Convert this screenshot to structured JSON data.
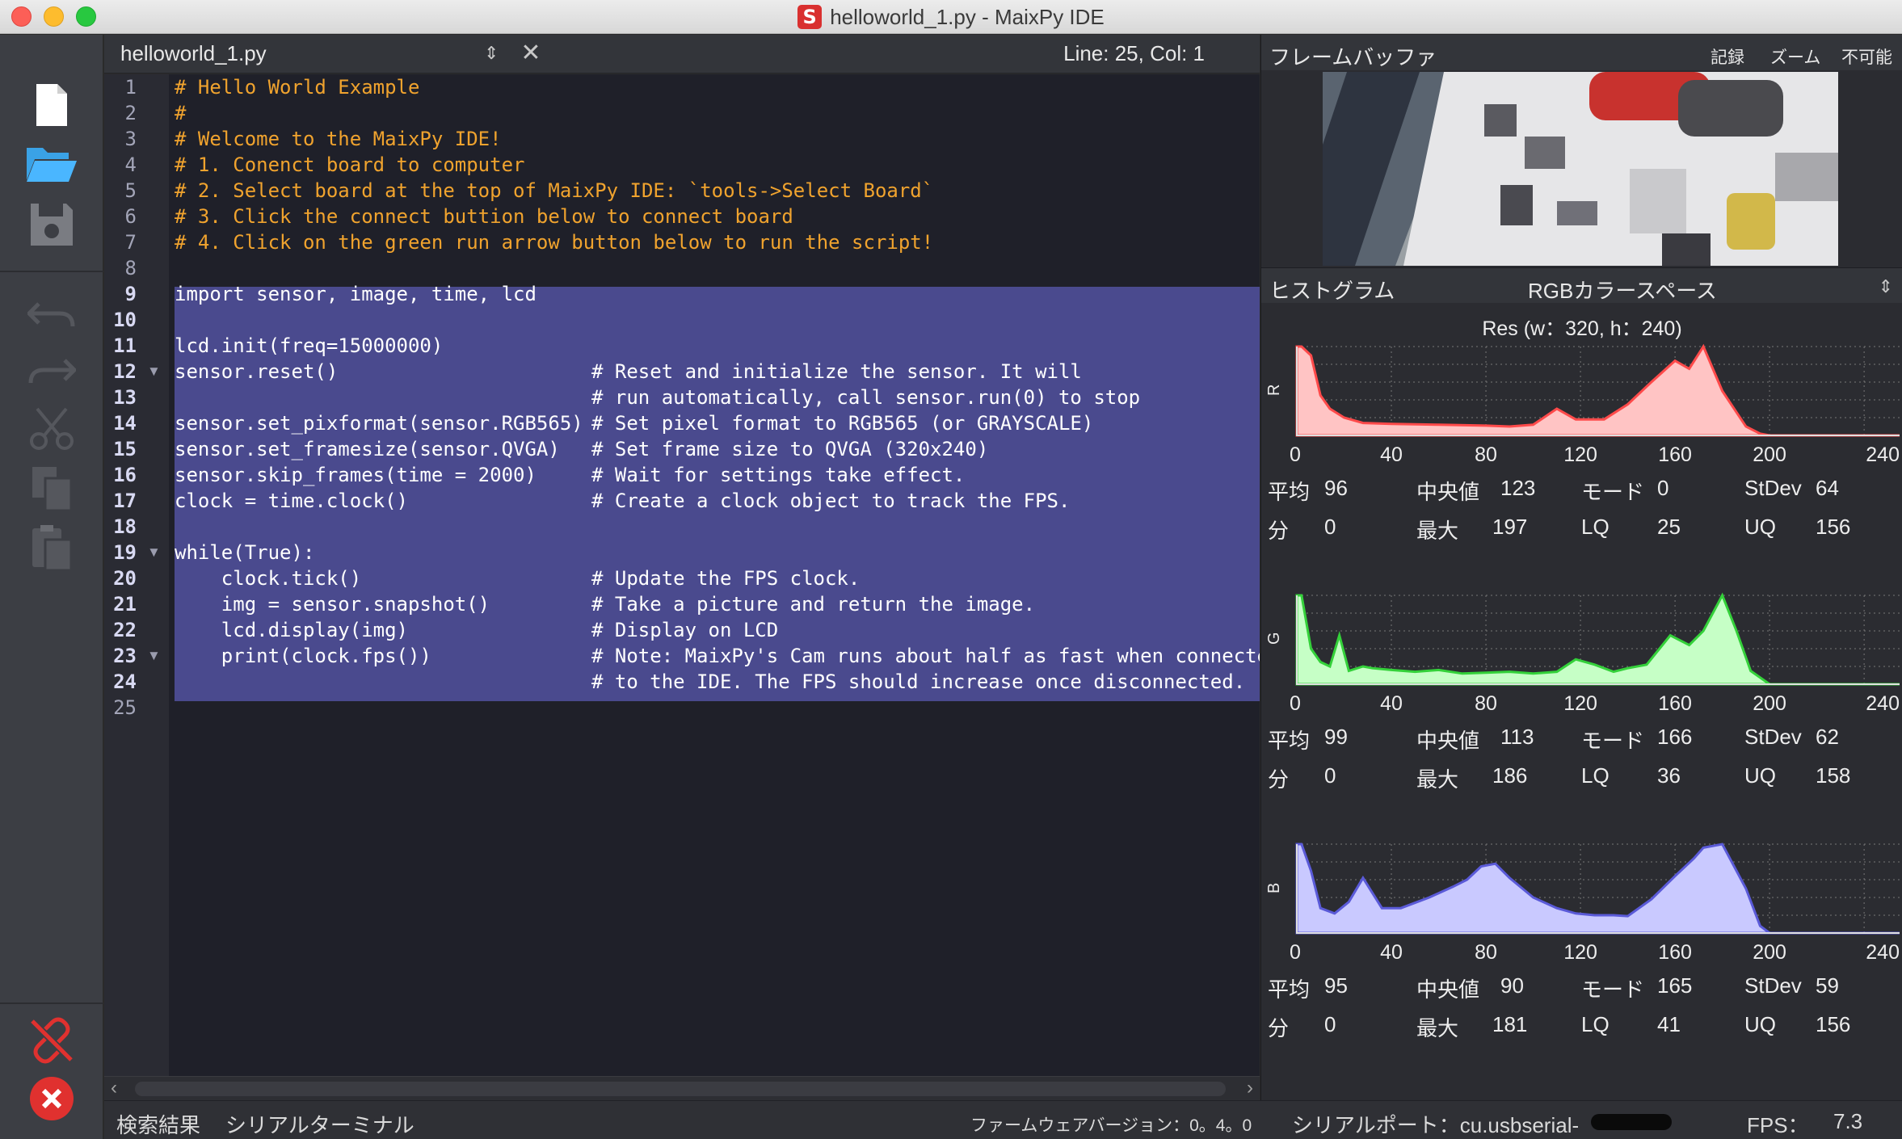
{
  "window": {
    "title": "helloworld_1.py - MaixPy IDE",
    "app_icon_letter": "S"
  },
  "editor": {
    "file_name": "helloworld_1.py",
    "position": "Line: 25, Col: 1",
    "lines": [
      {
        "n": "1",
        "text": "# Hello World Example",
        "kind": "comment"
      },
      {
        "n": "2",
        "text": "#",
        "kind": "comment"
      },
      {
        "n": "3",
        "text": "# Welcome to the MaixPy IDE!",
        "kind": "comment"
      },
      {
        "n": "4",
        "text": "# 1. Conenct board to computer",
        "kind": "comment"
      },
      {
        "n": "5",
        "text": "# 2. Select board at the top of MaixPy IDE: `tools->Select Board`",
        "kind": "comment"
      },
      {
        "n": "6",
        "text": "# 3. Click the connect buttion below to connect board",
        "kind": "comment"
      },
      {
        "n": "7",
        "text": "# 4. Click on the green run arrow button below to run the script!",
        "kind": "comment"
      },
      {
        "n": "8",
        "text": "",
        "kind": "comment"
      },
      {
        "n": "9",
        "text": "import sensor, image, time, lcd",
        "kind": "code"
      },
      {
        "n": "10",
        "text": "",
        "kind": "code"
      },
      {
        "n": "11",
        "text": "lcd.init(freq=15000000)",
        "kind": "code"
      },
      {
        "n": "12",
        "text": "sensor.reset()",
        "kind": "code",
        "comment": "# Reset and initialize the sensor. It will",
        "fold": true
      },
      {
        "n": "13",
        "text": "",
        "kind": "code",
        "comment": "# run automatically, call sensor.run(0) to stop"
      },
      {
        "n": "14",
        "text": "sensor.set_pixformat(sensor.RGB565)",
        "kind": "code",
        "comment": "# Set pixel format to RGB565 (or GRAYSCALE)"
      },
      {
        "n": "15",
        "text": "sensor.set_framesize(sensor.QVGA)",
        "kind": "code",
        "comment": "# Set frame size to QVGA (320x240)"
      },
      {
        "n": "16",
        "text": "sensor.skip_frames(time = 2000)",
        "kind": "code",
        "comment": "# Wait for settings take effect."
      },
      {
        "n": "17",
        "text": "clock = time.clock()",
        "kind": "code",
        "comment": "# Create a clock object to track the FPS."
      },
      {
        "n": "18",
        "text": "",
        "kind": "code"
      },
      {
        "n": "19",
        "text": "while(True):",
        "kind": "code",
        "fold": true
      },
      {
        "n": "20",
        "text": "    clock.tick()",
        "kind": "code",
        "comment": "# Update the FPS clock."
      },
      {
        "n": "21",
        "text": "    img = sensor.snapshot()",
        "kind": "code",
        "comment": "# Take a picture and return the image."
      },
      {
        "n": "22",
        "text": "    lcd.display(img)",
        "kind": "code",
        "comment": "# Display on LCD"
      },
      {
        "n": "23",
        "text": "    print(clock.fps())",
        "kind": "code",
        "comment": "# Note: MaixPy's Cam runs about half as fast when connecte",
        "fold": true
      },
      {
        "n": "24",
        "text": "",
        "kind": "code",
        "comment": "# to the IDE. The FPS should increase once disconnected."
      },
      {
        "n": "25",
        "text": "",
        "kind": "plain"
      }
    ]
  },
  "framebuffer": {
    "title": "フレームバッファ",
    "record": "記録",
    "zoom": "ズーム",
    "disable": "不可能"
  },
  "histogram": {
    "title": "ヒストグラム",
    "color_space": "RGBカラースペース",
    "resolution": "Res (w：320, h：240)",
    "x_ticks": [
      "0",
      "40",
      "80",
      "120",
      "160",
      "200",
      "240"
    ],
    "labels": {
      "mean": "平均",
      "median": "中央値",
      "mode": "モード",
      "stdev": "StDev",
      "min": "分",
      "max": "最大",
      "lq": "LQ",
      "uq": "UQ"
    },
    "channels": [
      {
        "name": "R",
        "color": "#ff4a4a",
        "fill": "#ffc4c4",
        "mean": "96",
        "median": "123",
        "mode": "0",
        "stdev": "64",
        "min": "0",
        "max": "197",
        "lq": "25",
        "uq": "156"
      },
      {
        "name": "G",
        "color": "#34d13a",
        "fill": "#c6ffc6",
        "mean": "99",
        "median": "113",
        "mode": "166",
        "stdev": "62",
        "min": "0",
        "max": "186",
        "lq": "36",
        "uq": "158"
      },
      {
        "name": "B",
        "color": "#5a5ad8",
        "fill": "#c9c9ff",
        "mean": "95",
        "median": "90",
        "mode": "165",
        "stdev": "59",
        "min": "0",
        "max": "181",
        "lq": "41",
        "uq": "156"
      }
    ]
  },
  "chart_data": [
    {
      "type": "area",
      "series": [
        {
          "name": "R",
          "x": [
            0,
            2,
            6,
            10,
            14,
            20,
            28,
            40,
            60,
            80,
            90,
            100,
            110,
            118,
            130,
            140,
            150,
            160,
            166,
            172,
            180,
            190,
            196,
            200,
            220,
            240,
            255
          ],
          "values": [
            100,
            100,
            90,
            45,
            30,
            20,
            14,
            13,
            12,
            11,
            10,
            12,
            30,
            18,
            18,
            35,
            60,
            84,
            75,
            100,
            50,
            10,
            2,
            0,
            0,
            0,
            0
          ]
        }
      ]
    },
    {
      "type": "area",
      "series": [
        {
          "name": "G",
          "x": [
            0,
            2,
            6,
            10,
            14,
            18,
            22,
            28,
            32,
            40,
            50,
            60,
            70,
            80,
            90,
            100,
            110,
            118,
            126,
            134,
            140,
            148,
            158,
            166,
            172,
            180,
            186,
            192,
            200,
            220,
            240,
            255
          ],
          "values": [
            100,
            100,
            40,
            25,
            20,
            55,
            15,
            20,
            18,
            16,
            14,
            16,
            12,
            13,
            14,
            12,
            14,
            28,
            22,
            14,
            18,
            22,
            55,
            44,
            60,
            100,
            60,
            15,
            0,
            0,
            0,
            0
          ]
        }
      ]
    },
    {
      "type": "area",
      "series": [
        {
          "name": "B",
          "x": [
            0,
            2,
            6,
            10,
            16,
            22,
            28,
            36,
            44,
            56,
            66,
            72,
            78,
            84,
            90,
            100,
            110,
            118,
            126,
            134,
            140,
            150,
            160,
            168,
            172,
            180,
            190,
            196,
            200,
            220,
            240,
            255
          ],
          "values": [
            100,
            100,
            70,
            28,
            22,
            35,
            62,
            28,
            28,
            40,
            52,
            60,
            75,
            78,
            62,
            40,
            28,
            22,
            20,
            20,
            19,
            38,
            64,
            84,
            96,
            100,
            50,
            8,
            0,
            0,
            0,
            0
          ]
        }
      ]
    }
  ],
  "statusbar": {
    "search_results": "検索結果",
    "serial_terminal": "シリアルターミナル",
    "firmware": "ファームウェアバージョン：0。4。0",
    "serial_port": "シリアルポート：cu.usbserial-",
    "fps": "FPS：",
    "fps_value": "7.3"
  }
}
